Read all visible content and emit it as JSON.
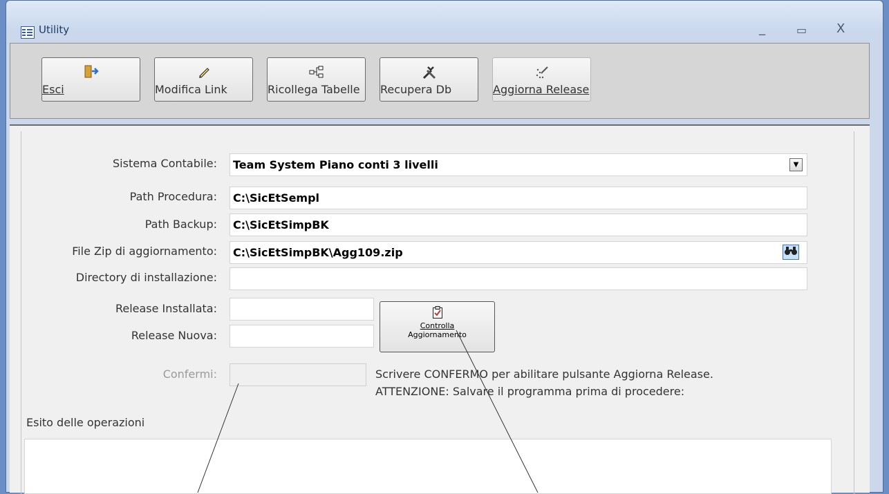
{
  "window": {
    "title": "Utility",
    "controls": {
      "minimize": "_",
      "maximize": "▭",
      "close": "X"
    }
  },
  "toolbar": {
    "buttons": [
      {
        "label": "Esci",
        "icon": "exit-door-icon",
        "enabled": true
      },
      {
        "label": "Modifica Link",
        "icon": "pencil-icon",
        "enabled": true
      },
      {
        "label": "Ricollega Tabelle",
        "icon": "hierarchy-icon",
        "enabled": true
      },
      {
        "label": "Recupera Db",
        "icon": "tools-icon",
        "enabled": true
      },
      {
        "label": "Aggiorna Release",
        "icon": "dotted-wand-icon",
        "enabled": false
      }
    ]
  },
  "form": {
    "sistema_contabile": {
      "label": "Sistema Contabile:",
      "value": "Team System Piano conti 3 livelli"
    },
    "path_procedura": {
      "label": "Path Procedura:",
      "value": "C:\\SicEtSempl"
    },
    "path_backup": {
      "label": "Path Backup:",
      "value": "C:\\SicEtSimpBK"
    },
    "file_zip": {
      "label": "File Zip di aggiornamento:",
      "value": "C:\\SicEtSimpBK\\Agg109.zip"
    },
    "directory_installazione": {
      "label": "Directory di installazione:",
      "value": ""
    },
    "release_installata": {
      "label": "Release Installata:",
      "value": ""
    },
    "release_nuova": {
      "label": "Release Nuova:",
      "value": ""
    },
    "confermi": {
      "label": "Confermi:",
      "value": ""
    },
    "controlla_button": {
      "line1": "Controlla",
      "line2": "Aggiornamento"
    },
    "info_line1": "Scrivere CONFERMO per abilitare pulsante Aggiorna Release.",
    "info_line2": "ATTENZIONE: Salvare il programma prima di procedere:",
    "esito_label": "Esito delle operazioni",
    "esito_value": ""
  }
}
